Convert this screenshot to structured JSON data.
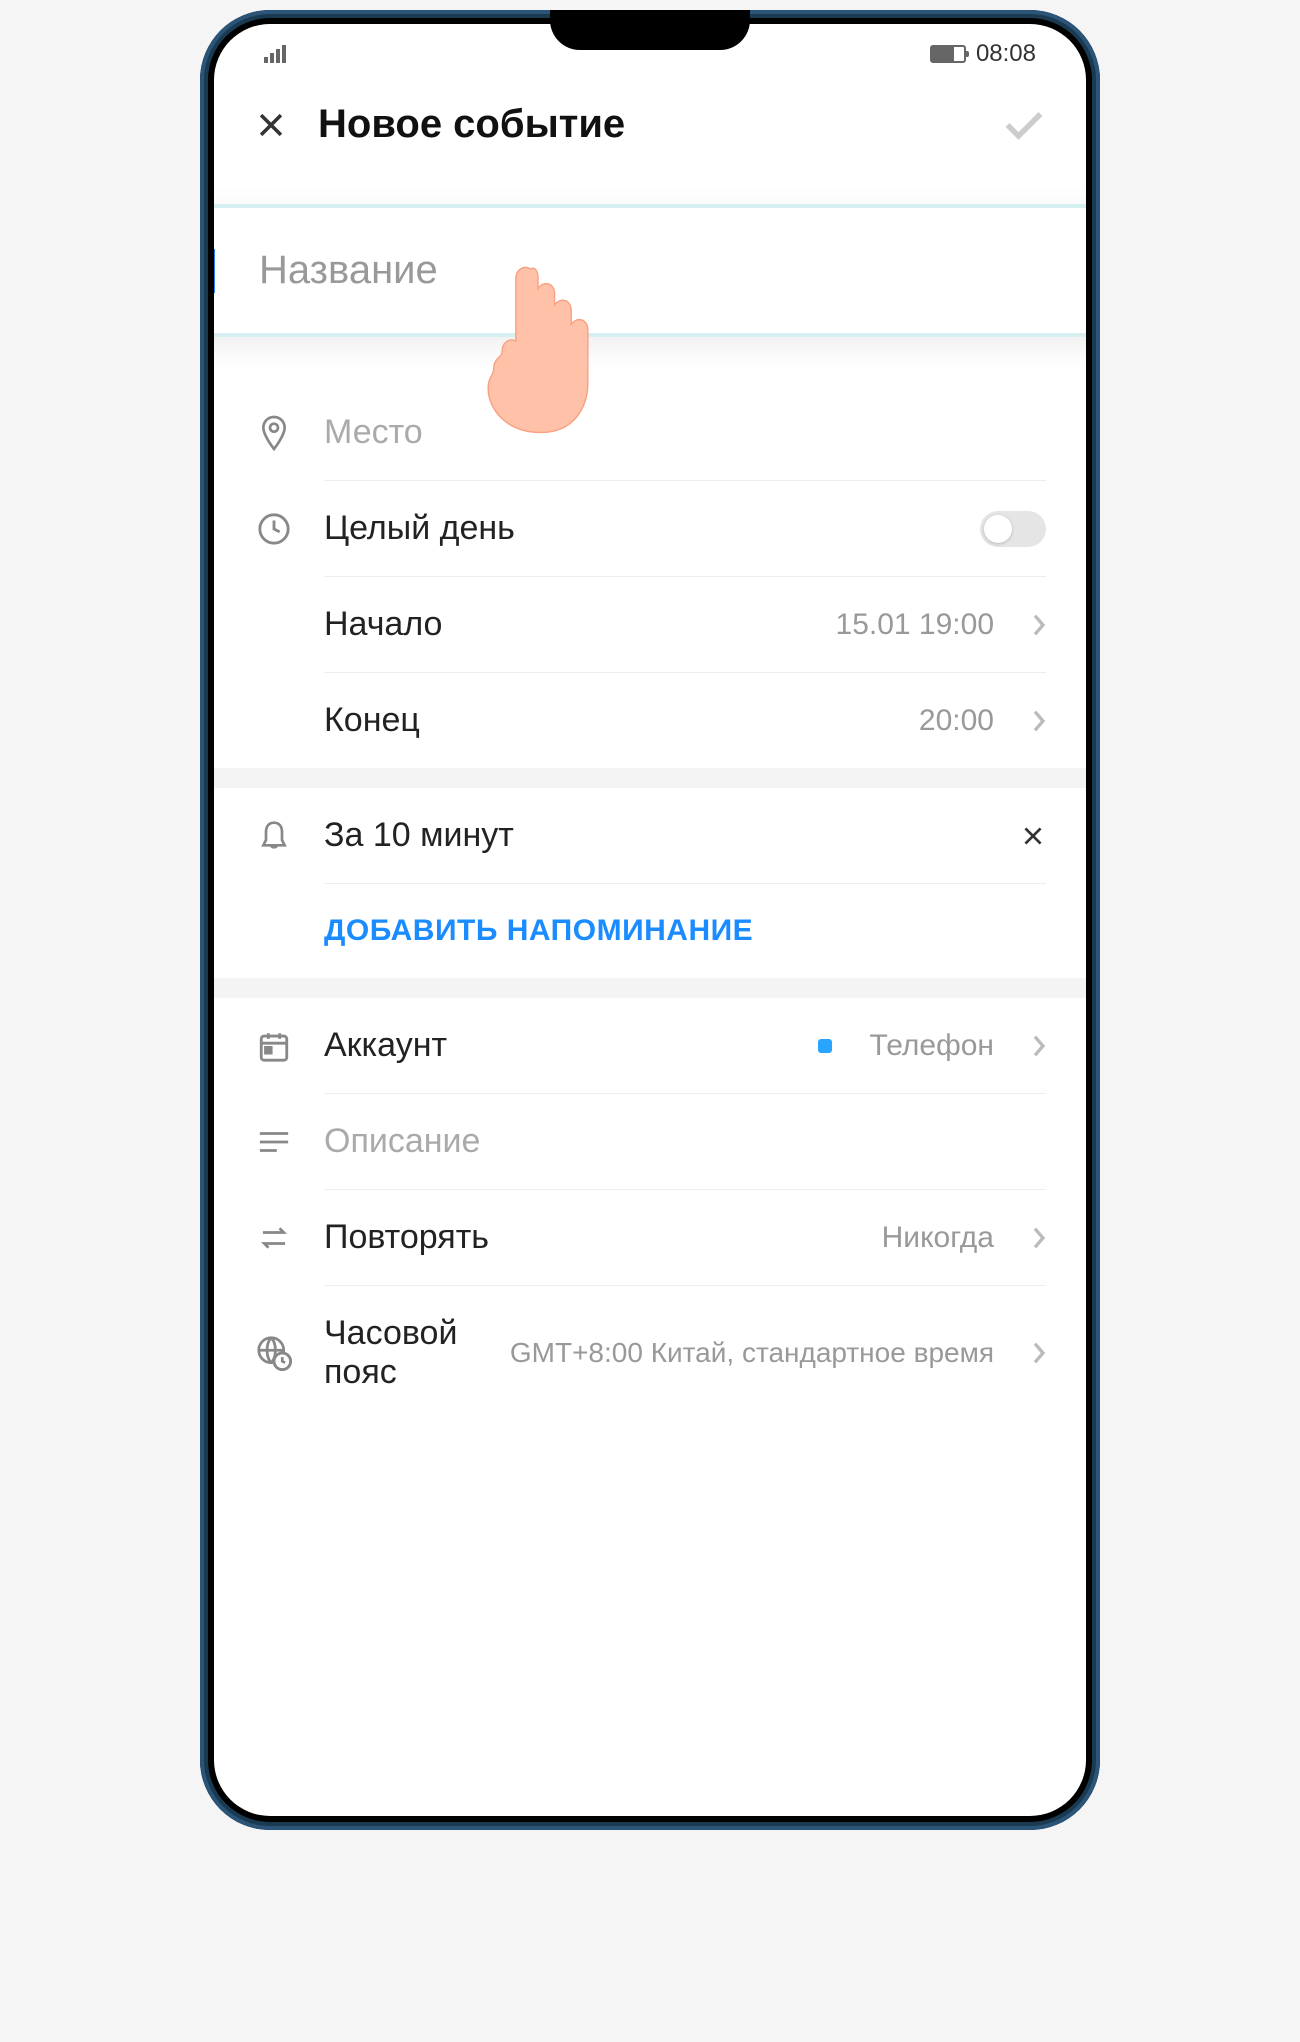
{
  "status": {
    "time": "08:08"
  },
  "header": {
    "title": "Новое событие"
  },
  "fields": {
    "title_placeholder": "Название",
    "location_placeholder": "Место",
    "allday_label": "Целый день",
    "start_label": "Начало",
    "start_value": "15.01 19:00",
    "end_label": "Конец",
    "end_value": "20:00",
    "reminder_label": "За 10 минут",
    "add_reminder": "ДОБАВИТЬ НАПОМИНАНИЕ",
    "account_label": "Аккаунт",
    "account_value": "Телефон",
    "description_placeholder": "Описание",
    "repeat_label": "Повторять",
    "repeat_value": "Никогда",
    "timezone_label": "Часовой пояс",
    "timezone_value": "GMT+8:00 Китай, стандартное время"
  }
}
